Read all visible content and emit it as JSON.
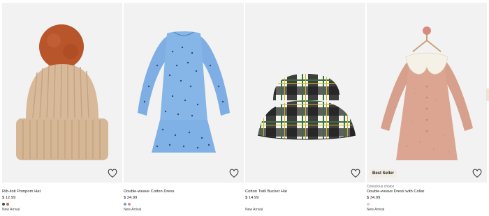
{
  "products": [
    {
      "name": "Rib-knit Pompom Hat",
      "price": "$ 12.99",
      "tag": "New Arrival",
      "swatches": [
        "#4a4a4a",
        "#c46b3b"
      ],
      "image_icon": "pompom-hat"
    },
    {
      "name": "Double-weave Cotton Dress",
      "price": "$ 24.99",
      "tag": "New Arrival",
      "swatches": [
        "#6f9fd8",
        "#d88aa0"
      ],
      "image_icon": "blue-dress"
    },
    {
      "name": "Cotton Twill Bucket Hat",
      "price": "$ 14.99",
      "tag": "New Arrival",
      "swatches": [],
      "image_icon": "bucket-hat"
    },
    {
      "pre_label": "Conscious choice",
      "name": "Double-weave Dress with Collar",
      "price": "$ 34.99",
      "tag": "New Arrival",
      "badge": "Best Seller",
      "swatches": [
        "#e8c9bc"
      ],
      "image_icon": "collar-dress"
    }
  ],
  "colors": {
    "card_bg": "#f2f2f2",
    "badge_bg": "#f3eee4"
  }
}
